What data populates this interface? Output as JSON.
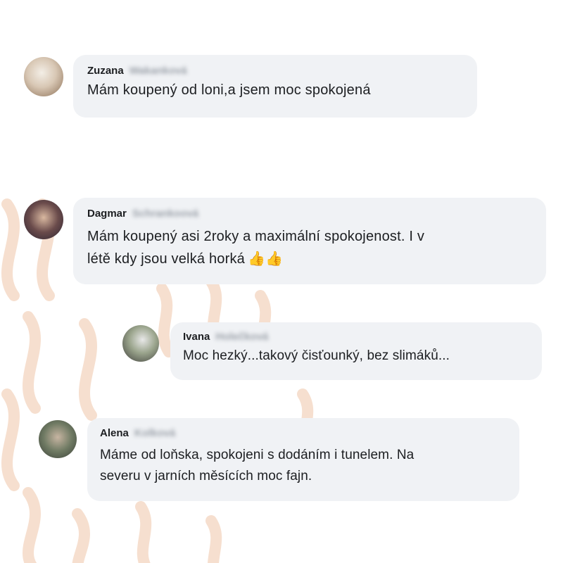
{
  "colors": {
    "bubble_bg": "#f0f2f5",
    "text": "#1c1e21",
    "decoration": "#f6dfcf"
  },
  "comments": [
    {
      "author": "Zuzana",
      "author_surname_blurred": "Wakanková",
      "text": "Mám koupený od loni,a jsem moc spokojená",
      "avatar_icon": "profile-photo"
    },
    {
      "author": "Dagmar",
      "author_surname_blurred": "Schrankoová",
      "text": "Mám koupený asi 2roky a maximální spokojenost. I v\nlétě kdy jsou velká horká",
      "emoji": "👍👍",
      "avatar_icon": "profile-photo"
    },
    {
      "author": "Ivana",
      "author_surname_blurred": "Holečková",
      "text": "Moc hezký...takový čisťounký, bez slimáků...",
      "avatar_icon": "profile-photo"
    },
    {
      "author": "Alena",
      "author_surname_blurred": "Kolková",
      "text": "Máme od loňska, spokojeni s dodáním i tunelem. Na\nseveru v jarních měsících moc fajn.",
      "avatar_icon": "profile-photo"
    }
  ]
}
